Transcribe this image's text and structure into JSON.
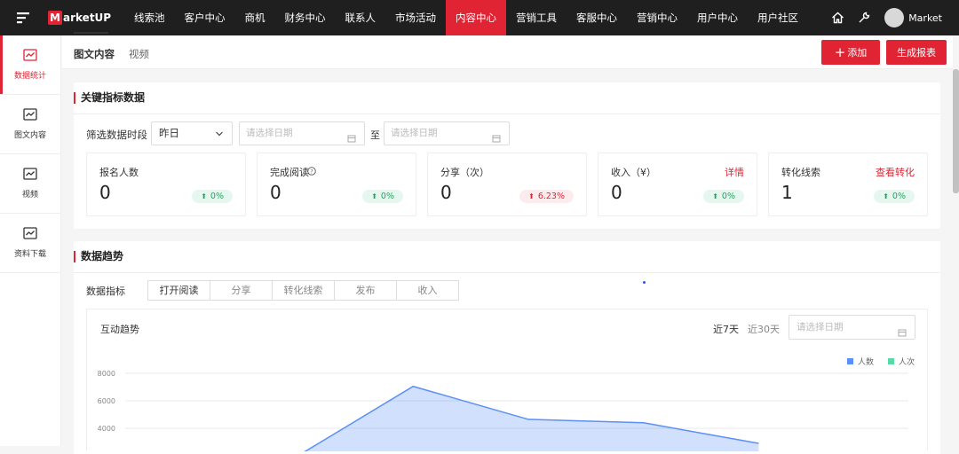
{
  "topnav": {
    "logo_letter": "M",
    "logo_text": "arketUP",
    "items": [
      "线索池",
      "客户中心",
      "商机",
      "财务中心",
      "联系人",
      "市场活动",
      "内容中心",
      "营销工具",
      "客服中心",
      "营销中心",
      "用户中心",
      "用户社区"
    ],
    "active_item": "内容中心",
    "user_name": "Market"
  },
  "sidebar": {
    "items": [
      "数据统计",
      "图文内容",
      "视频",
      "资料下载"
    ],
    "active_item": "数据统计"
  },
  "subtabs": {
    "items": [
      "图文内容",
      "视频"
    ],
    "active_item": "图文内容"
  },
  "actions": {
    "add": "添加",
    "report": "生成报表"
  },
  "key_metrics": {
    "title": "关键指标数据",
    "filter_label": "筛选数据时段",
    "period": "昨日",
    "start_placeholder": "请选择日期",
    "to_label": "至",
    "end_placeholder": "请选择日期",
    "stats": [
      {
        "label": "报名人数",
        "value": "0",
        "change": "0%",
        "trend": "up",
        "link": ""
      },
      {
        "label": "完成阅读",
        "value": "0",
        "change": "0%",
        "trend": "up",
        "link": ""
      },
      {
        "label": "分享（次）",
        "value": "0",
        "change": "6.23%",
        "trend": "up-red",
        "link": ""
      },
      {
        "label": "收入（¥）",
        "value": "0",
        "change": "0%",
        "trend": "up",
        "link": "详情"
      },
      {
        "label": "转化线索",
        "value": "1",
        "change": "0%",
        "trend": "up",
        "link": "查看转化"
      }
    ]
  },
  "trend": {
    "title": "数据趋势",
    "metric_label": "数据指标",
    "metric_tabs": [
      "打开阅读",
      "分享",
      "转化线索",
      "发布",
      "收入"
    ],
    "active_metric": "打开阅读",
    "chart_title": "互动趋势",
    "ranges": [
      "近7天",
      "近30天"
    ],
    "active_range": "近7天",
    "date_placeholder": "请选择日期"
  },
  "colors": {
    "accent": "#e02433",
    "series_people": "#5b8ff9",
    "series_times": "#5ad8a6"
  },
  "chart_data": {
    "type": "area",
    "title": "互动趋势",
    "xlabel": "",
    "ylabel": "",
    "y_ticks": [
      4000,
      6000,
      8000
    ],
    "ylim": [
      0,
      8600
    ],
    "grid": true,
    "legend_position": "top-right",
    "series": [
      {
        "name": "人数",
        "color": "#5b8ff9",
        "points": [
          [
            0,
            2000
          ],
          [
            1,
            7050
          ],
          [
            2,
            4650
          ],
          [
            3,
            4400
          ],
          [
            4,
            2900
          ]
        ]
      },
      {
        "name": "人次",
        "color": "#5ad8a6",
        "points": []
      }
    ],
    "x_range": [
      -1.5,
      5.3
    ]
  }
}
